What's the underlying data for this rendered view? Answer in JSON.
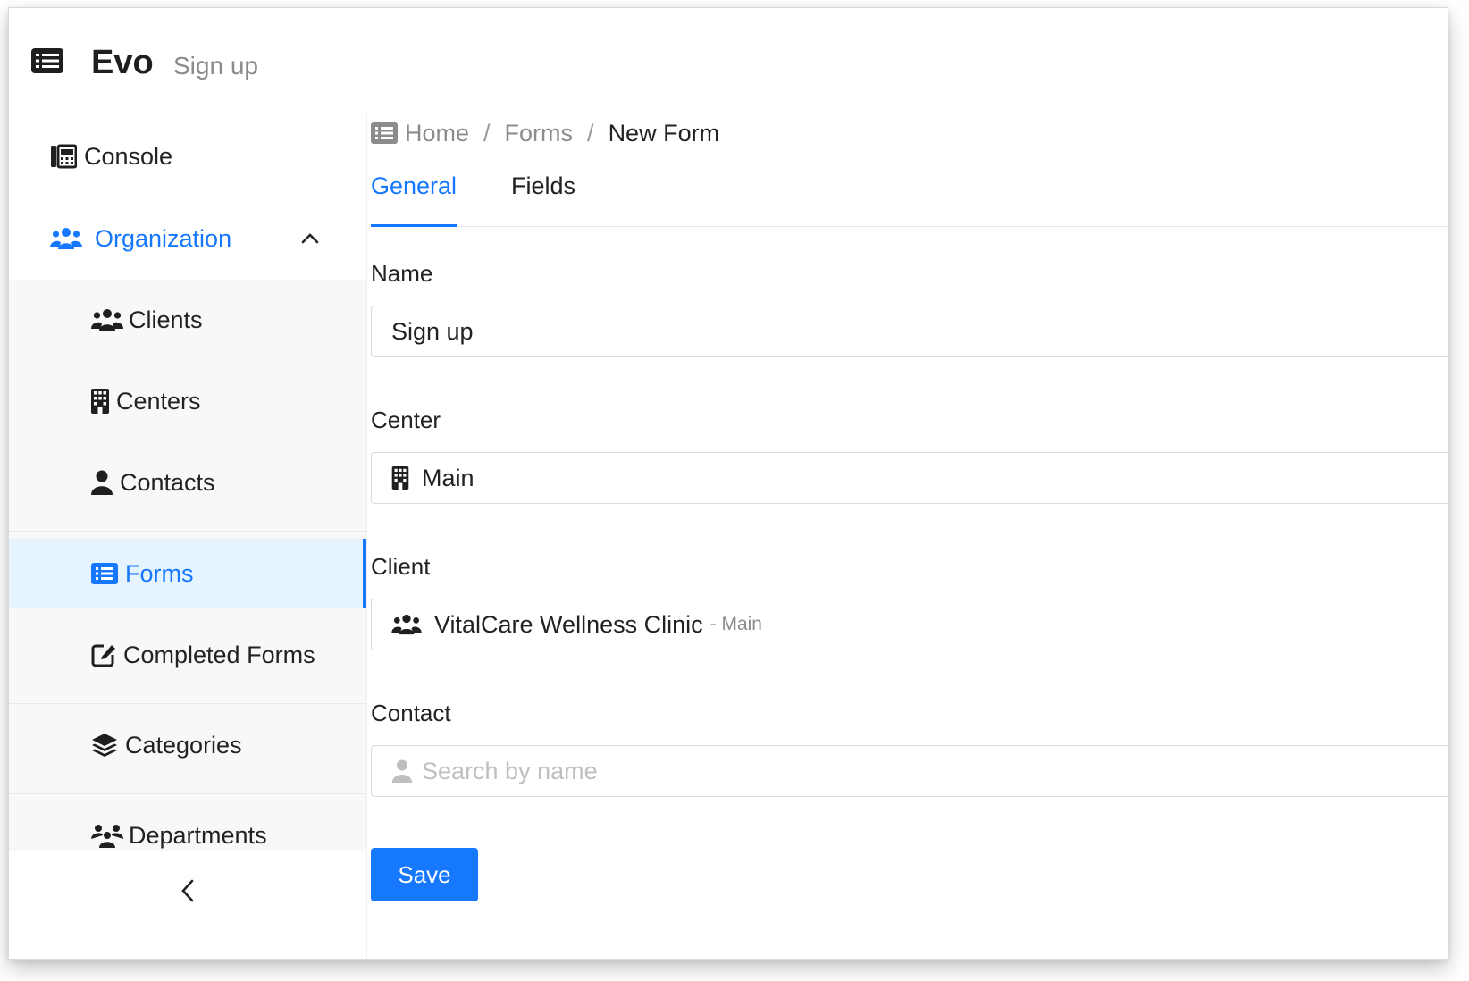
{
  "header": {
    "app_title": "Evo",
    "page_subtitle": "Sign up",
    "menu_icon": "list-icon"
  },
  "sidebar": {
    "items": [
      {
        "label": "Console",
        "icon": "console-icon"
      },
      {
        "label": "Organization",
        "icon": "users-icon",
        "expanded": true
      },
      {
        "label": "Clients",
        "icon": "users-icon"
      },
      {
        "label": "Centers",
        "icon": "building-icon"
      },
      {
        "label": "Contacts",
        "icon": "user-icon"
      },
      {
        "label": "Forms",
        "icon": "list-icon",
        "active": true
      },
      {
        "label": "Completed Forms",
        "icon": "edit-icon"
      },
      {
        "label": "Categories",
        "icon": "layers-icon"
      },
      {
        "label": "Departments",
        "icon": "users-group-icon"
      }
    ],
    "collapse_icon": "chevron-left-icon"
  },
  "breadcrumb": {
    "items": [
      "Home",
      "Forms",
      "New Form"
    ],
    "separator": "/"
  },
  "tabs": [
    {
      "label": "General",
      "active": true
    },
    {
      "label": "Fields",
      "active": false
    }
  ],
  "form": {
    "name": {
      "label": "Name",
      "value": "Sign up"
    },
    "center": {
      "label": "Center",
      "value": "Main"
    },
    "client": {
      "label": "Client",
      "value": "VitalCare Wellness Clinic",
      "suffix": "- Main"
    },
    "contact": {
      "label": "Contact",
      "placeholder": "Search by name"
    },
    "save_label": "Save"
  },
  "colors": {
    "accent": "#1677ff",
    "active_bg": "#e6f4ff",
    "sub_menu_bg": "#f8f8f8"
  }
}
